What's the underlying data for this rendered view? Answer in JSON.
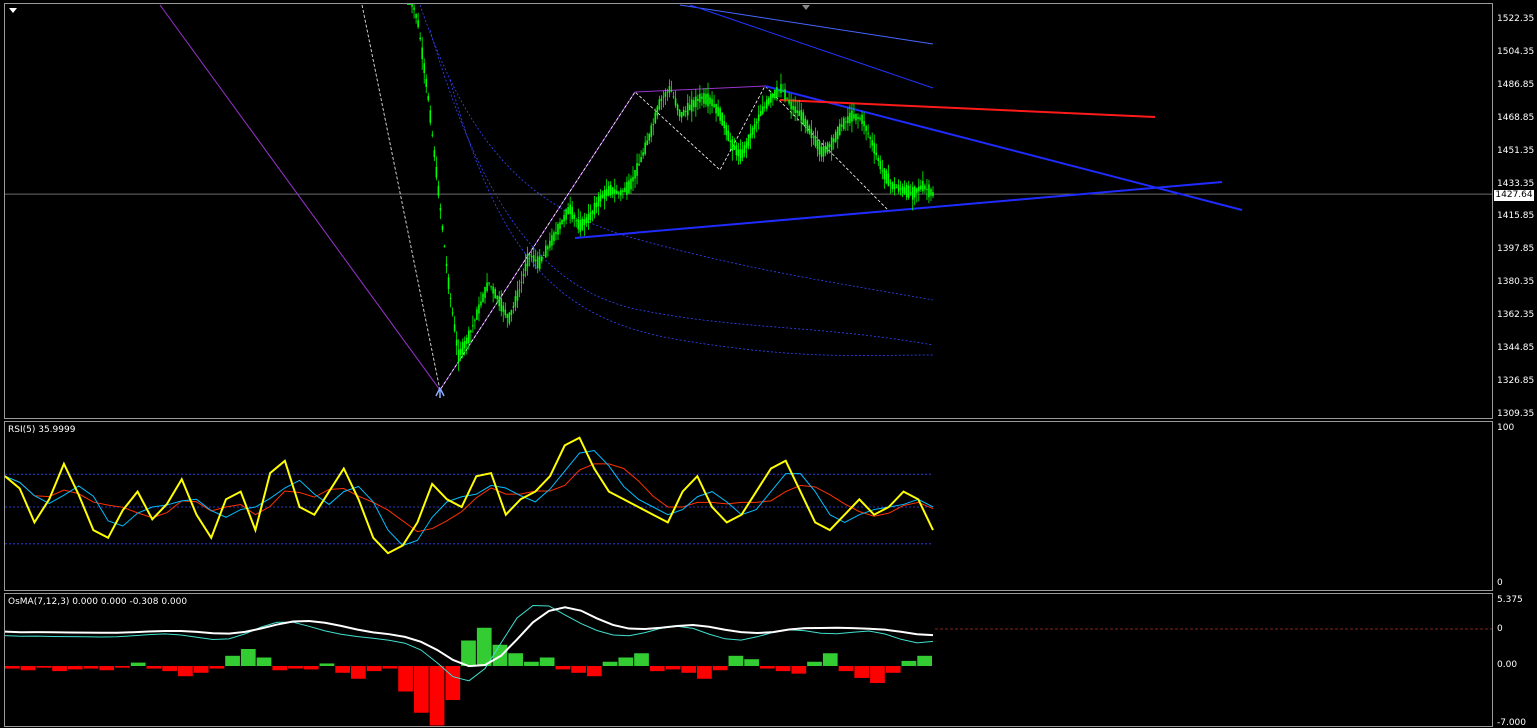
{
  "price_pane": {
    "current_price": "1427.64",
    "ticks": [
      "1522.35",
      "1504.35",
      "1486.85",
      "1468.85",
      "1451.35",
      "1433.35",
      "1415.85",
      "1397.85",
      "1380.35",
      "1362.35",
      "1344.85",
      "1326.85",
      "1309.35"
    ],
    "ylim": [
      1309.35,
      1530
    ]
  },
  "rsi_pane": {
    "label": "RSI(5) 35.9999",
    "ticks": [
      "100",
      "0"
    ],
    "levels": [
      70,
      50,
      30
    ]
  },
  "osma_pane": {
    "label": "OsMA(7,12,3) 0.000 0.000 -0.308 0.000",
    "ticks": [
      "5.375",
      "0",
      "0.00",
      "-7.000"
    ]
  },
  "colors": {
    "candle": "#00ff00",
    "trendline_blue": "#1f2bff",
    "trendline_red": "#ff1a1a",
    "zigzag": "#9933cc",
    "rsi": "#ffff00",
    "rsi_signal": "#00bfff",
    "rsi_slow": "#ff3300",
    "osma_pos": "#33cc33",
    "osma_neg": "#ff0000",
    "macd_main": "#ffffff",
    "macd_signal": "#40e0d0"
  },
  "chart_data": [
    {
      "type": "candlestick",
      "title": "",
      "xlabel": "",
      "ylabel": "",
      "ylim": [
        1309.35,
        1530
      ],
      "close_path": [
        1540,
        1520,
        1480,
        1430,
        1380,
        1340,
        1350,
        1365,
        1380,
        1370,
        1360,
        1375,
        1395,
        1390,
        1400,
        1410,
        1420,
        1410,
        1415,
        1425,
        1430,
        1428,
        1432,
        1445,
        1460,
        1478,
        1485,
        1470,
        1475,
        1480,
        1478,
        1470,
        1455,
        1448,
        1460,
        1472,
        1480,
        1485,
        1475,
        1470,
        1460,
        1450,
        1455,
        1465,
        1470,
        1468,
        1455,
        1440,
        1432,
        1430,
        1428,
        1432,
        1427.64
      ],
      "annotations": {
        "current_price": 1427.64
      }
    },
    {
      "type": "line",
      "title": "RSI(5) 35.9999",
      "ylim": [
        0,
        100
      ],
      "series": [
        {
          "values": [
            70,
            62,
            40,
            55,
            78,
            58,
            35,
            30,
            48,
            60,
            42,
            52,
            68,
            45,
            30,
            55,
            60,
            35,
            72,
            80,
            50,
            45,
            60,
            75,
            55,
            30,
            20,
            25,
            40,
            65,
            55,
            50,
            70,
            72,
            45,
            55,
            60,
            70,
            90,
            95,
            75,
            60,
            55,
            50,
            45,
            40,
            60,
            70,
            50,
            40,
            45,
            60,
            75,
            80,
            60,
            40,
            35,
            45,
            55,
            45,
            50,
            60,
            55,
            35
          ]
        }
      ]
    },
    {
      "type": "bar",
      "title": "OsMA(7,12,3) 0.000 0.000 -0.308 0.000",
      "series": [
        {
          "values": [
            -0.3,
            -0.5,
            -0.2,
            -0.6,
            -0.4,
            -0.3,
            -0.5,
            -0.2,
            0.4,
            -0.3,
            -0.6,
            -1.2,
            -0.8,
            -0.3,
            1.2,
            2.0,
            1.0,
            -0.5,
            -0.3,
            -0.4,
            0.3,
            -0.8,
            -1.5,
            -0.6,
            -0.3,
            -3.0,
            -5.5,
            -7.0,
            -4.0,
            3.0,
            4.5,
            2.5,
            1.5,
            0.5,
            1.0,
            -0.4,
            -0.8,
            -1.2,
            0.5,
            1.0,
            1.5,
            -0.6,
            -0.4,
            -0.8,
            -1.5,
            -0.5,
            1.2,
            0.8,
            -0.3,
            -0.6,
            -0.9,
            0.5,
            1.5,
            -0.6,
            -1.4,
            -2.0,
            -0.8,
            0.6,
            1.2
          ]
        }
      ]
    }
  ]
}
